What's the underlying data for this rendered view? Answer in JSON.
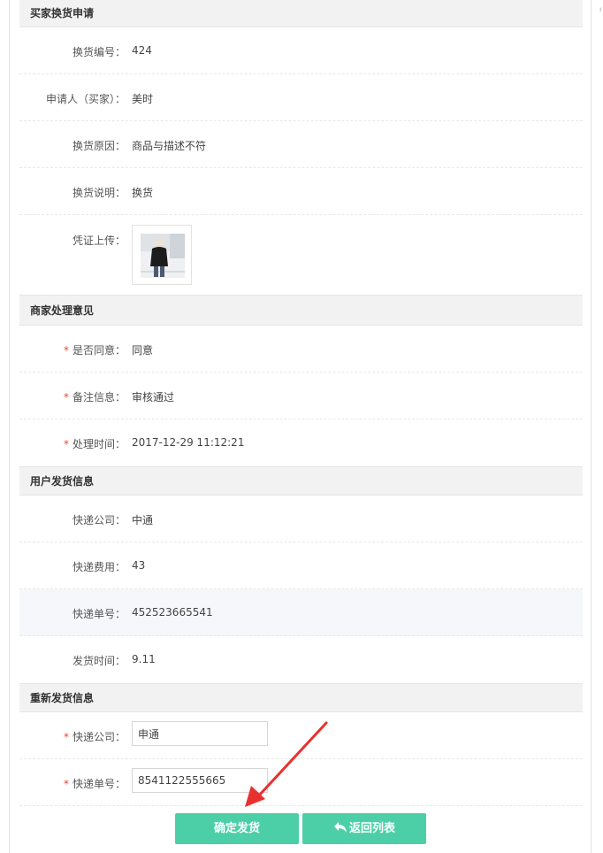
{
  "sections": {
    "buyer": {
      "title": "买家换货申请",
      "exchange_no_label": "换货编号：",
      "exchange_no": "424",
      "applicant_label": "申请人（买家）：",
      "applicant": "美时",
      "reason_label": "换货原因：",
      "reason": "商品与描述不符",
      "desc_label": "换货说明：",
      "desc": "换货",
      "voucher_label": "凭证上传："
    },
    "merchant": {
      "title": "商家处理意见",
      "agree_label": "是否同意：",
      "agree": "同意",
      "remark_label": "备注信息：",
      "remark": "审核通过",
      "time_label": "处理时间：",
      "time": "2017-12-29 11:12:21"
    },
    "user_ship": {
      "title": "用户发货信息",
      "company_label": "快递公司：",
      "company": "中通",
      "fee_label": "快递费用：",
      "fee": "43",
      "tracking_label": "快递单号：",
      "tracking": "452523665541",
      "ship_time_label": "发货时间：",
      "ship_time": "9.11"
    },
    "reship": {
      "title": "重新发货信息",
      "company_label": "快递公司：",
      "company_value": "申通",
      "tracking_label": "快递单号：",
      "tracking_value": "8541122555665"
    }
  },
  "required_mark": "*",
  "buttons": {
    "confirm": "确定发货",
    "back": "返回列表"
  },
  "colors": {
    "accent": "#4ccfa7",
    "required": "#e24b3b",
    "arrow": "#e8312f"
  }
}
